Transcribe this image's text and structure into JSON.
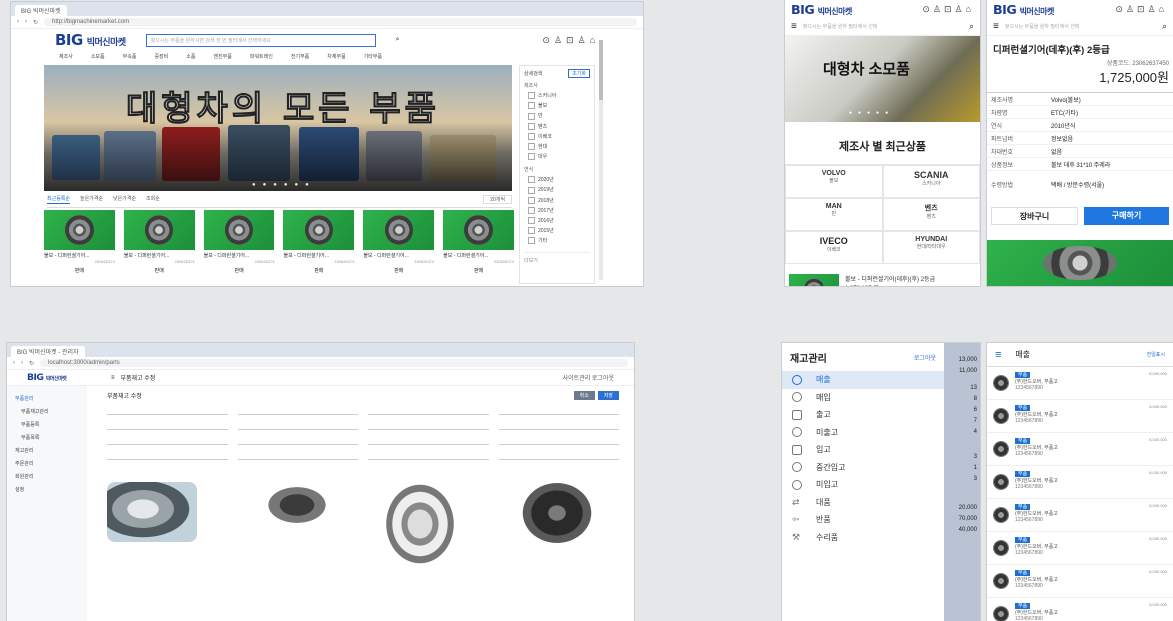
{
  "desktop": {
    "tab_title": "BIG 빅머신마켓",
    "url": "http://bigmachinemarket.com",
    "logo": "BIG",
    "logo_text": "빅머신마켓",
    "search_placeholder": "찾으시는 부품을 원하시면 검색 한 번 필터에서 선택하세요",
    "nav": [
      "제조사",
      "소모품",
      "부속품",
      "중장비",
      "소품",
      "엔진부품",
      "파워트레인",
      "전기부품",
      "차체부품",
      "기타부품"
    ],
    "hero_text": "대형차의 모든 부품",
    "tabs": [
      "최근등록순",
      "높은가격순",
      "낮은가격순",
      "조회순"
    ],
    "sort": "20개씩",
    "filter_title": "상세검색",
    "filter_reset": "초기화",
    "filter_group1": "제조사",
    "filter_options1": [
      "스카니아",
      "볼보",
      "만",
      "벤츠",
      "이베코",
      "현대",
      "대우"
    ],
    "filter_group2": "연식",
    "filter_options2": [
      "2020년",
      "2019년",
      "2018년",
      "2017년",
      "2016년",
      "2015년",
      "기타"
    ],
    "filter_more": "더보기",
    "products": [
      {
        "name": "볼보 - 디퍼런셜기어...",
        "code": "230626374",
        "price": "판매"
      },
      {
        "name": "볼보 - 디퍼런셜기어...",
        "code": "230626374",
        "price": "판매"
      },
      {
        "name": "볼보 - 디퍼런셜기어...",
        "code": "230626374",
        "price": "판매"
      },
      {
        "name": "볼보 - 디퍼런셜기어...",
        "code": "230626374",
        "price": "판매"
      },
      {
        "name": "볼보 - 디퍼런셜기어...",
        "code": "230626374",
        "price": "판매"
      },
      {
        "name": "볼보 - 디퍼런셜기어...",
        "code": "230626374",
        "price": "판매"
      }
    ]
  },
  "mobile1": {
    "logo": "BIG",
    "logo_text": "빅머신마켓",
    "search_placeholder": "찾으시는 부품을 원하 필터에서 선택",
    "banner": "대형차 소모품",
    "section_title": "제조사 별 최근상품",
    "makers": [
      {
        "logo": "VOLVO",
        "name": "볼보"
      },
      {
        "logo": "SCANIA",
        "name": "스카니아"
      },
      {
        "logo": "MAN",
        "name": "만"
      },
      {
        "logo": "벤츠",
        "name": "벤츠"
      },
      {
        "logo": "IVECO",
        "name": "이베코"
      },
      {
        "logo": "HYUNDAI",
        "name": "현대/타타대우"
      }
    ],
    "bottom_item": "볼보 - 디퍼런셜기어(데후)(후) 2등급 1,278,105 원"
  },
  "mobile2": {
    "logo": "BIG",
    "logo_text": "빅머신마켓",
    "search_placeholder": "찾으시는 부품을 원하 필터에서 선택",
    "title": "디퍼런셜기어(데후)(후) 2등급",
    "code": "상품코드: 23062637450",
    "price": "1,725,000원",
    "specs": [
      {
        "label": "제조사명",
        "value": "Volvo(볼보)"
      },
      {
        "label": "차량명",
        "value": "ETC(기타)"
      },
      {
        "label": "연식",
        "value": "2010년식"
      },
      {
        "label": "파트넘버",
        "value": "정보없음"
      },
      {
        "label": "차대번호",
        "value": "없음"
      },
      {
        "label": "상품정보",
        "value": "볼보 데후 31*10 주레라"
      },
      {
        "label": "수령방법",
        "value": "택배 / 방문수령(서울)"
      }
    ],
    "cart": "장바구니",
    "buy": "구매하기"
  },
  "admin": {
    "tab_title": "BIG 빅머신마켓 - 관리자",
    "url": "localhost:3000/admin/parts",
    "logo": "BIG",
    "logo_text": "빅머신마켓",
    "page_title": "부품재고 수정",
    "header_right": "사이트관리 로그아웃",
    "side": [
      "부품관리",
      "부품재고관리",
      "부품등록",
      "부품목록",
      "재고관리",
      "주문관리",
      "회원관리",
      "설정"
    ],
    "btn_cancel": "취소",
    "btn_save": "저장",
    "form_title": "부품재고 수정"
  },
  "inventory": {
    "title": "재고관리",
    "logout": "로그아웃",
    "menu": [
      "매출",
      "매입",
      "출고",
      "미출고",
      "입고",
      "중간입고",
      "미입고",
      "대품",
      "반품",
      "수리품"
    ],
    "numbers": [
      "13,000",
      "11,000",
      "13",
      "8",
      "6",
      "7",
      "4",
      "3",
      "1",
      "3",
      "20,000",
      "70,000",
      "40,000"
    ]
  },
  "sales": {
    "title": "매출",
    "right": "전일표시",
    "badge": "부품",
    "company": "(주)한드오버, 부품고",
    "phone": "1234567890",
    "amount": "8,000,000",
    "rows": 8
  }
}
